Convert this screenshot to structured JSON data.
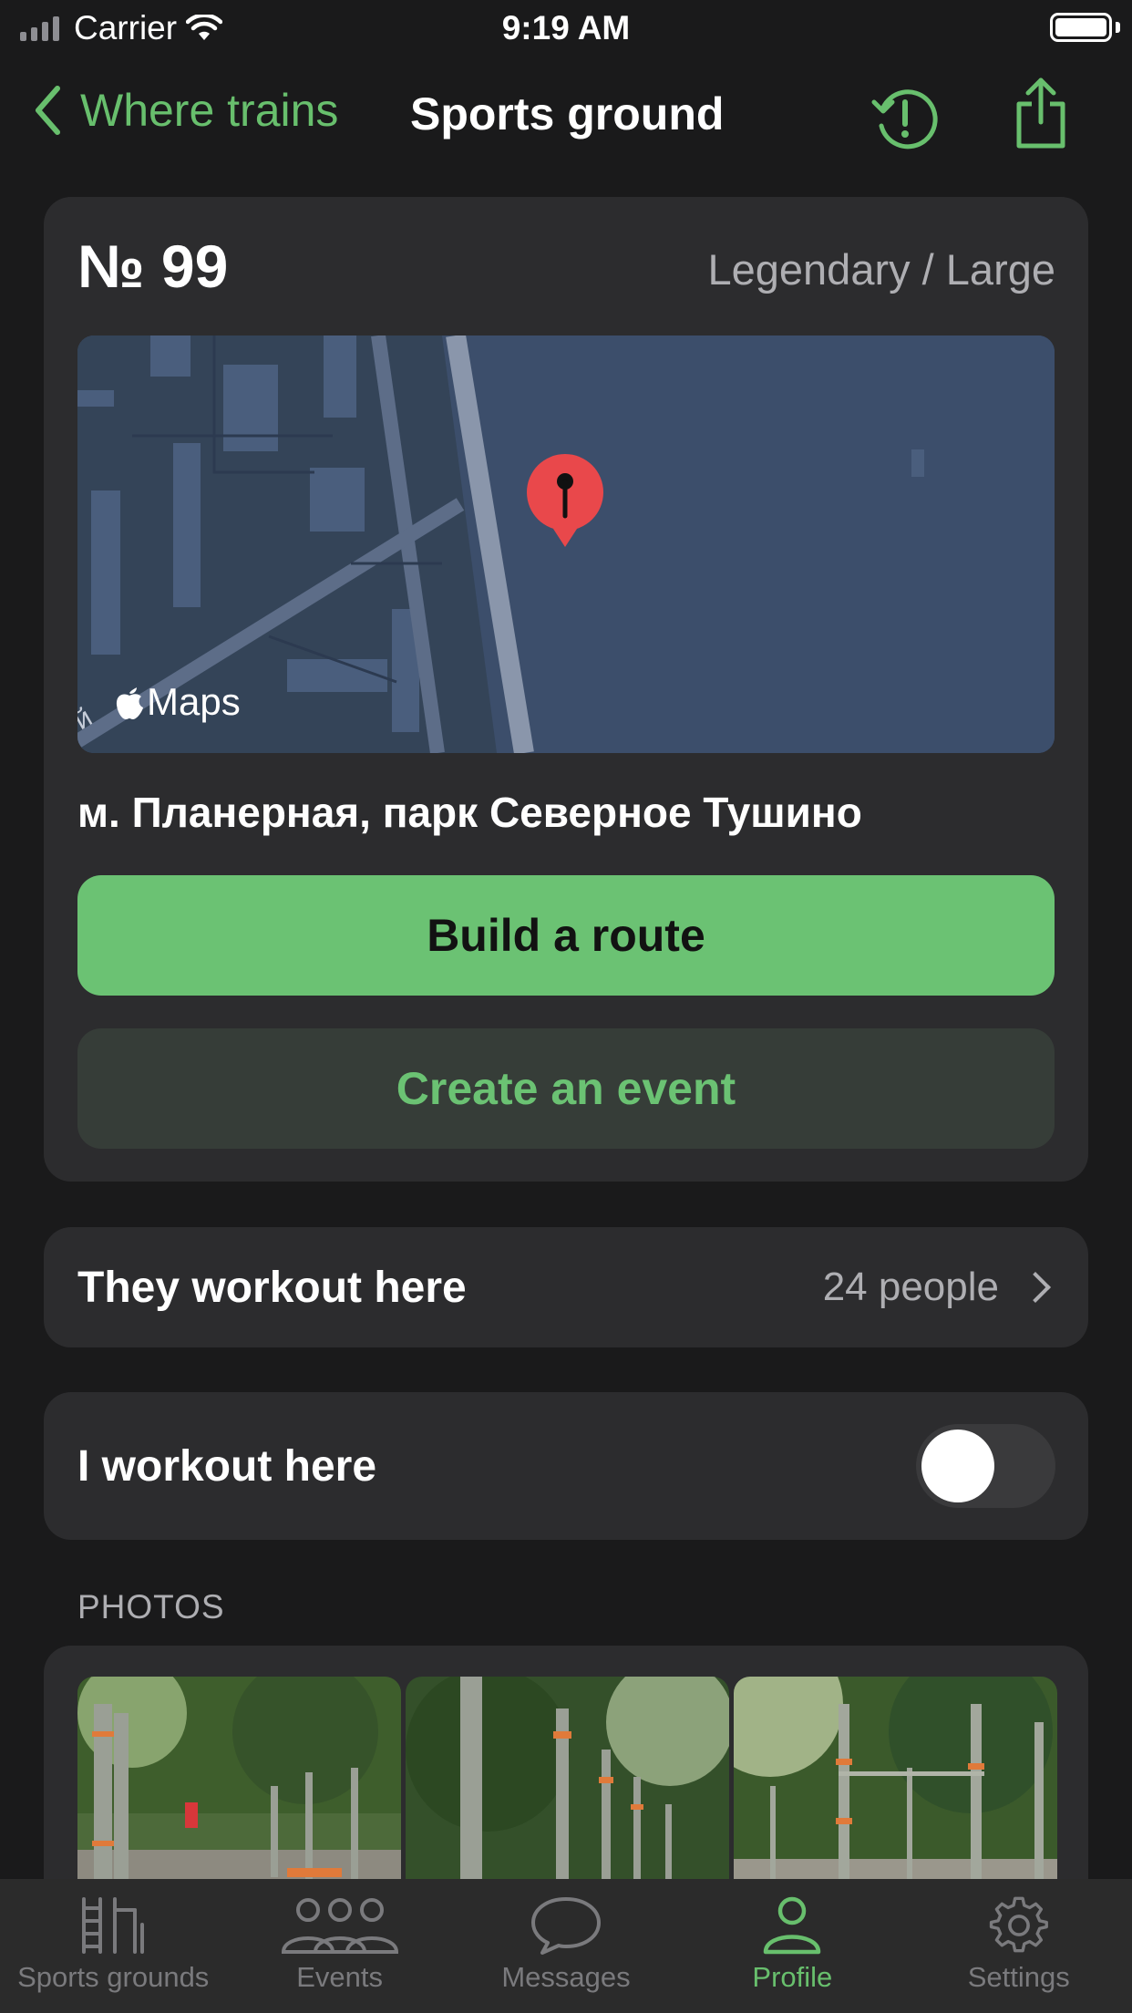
{
  "status_bar": {
    "carrier": "Carrier",
    "time": "9:19 AM"
  },
  "nav": {
    "back_label": "Where trains",
    "title": "Sports ground"
  },
  "ground": {
    "number": "№ 99",
    "grade": "Legendary / Large",
    "map_logo": "Maps",
    "map_edge_label": "й",
    "address": "м. Планерная, парк Северное Тушино"
  },
  "actions": {
    "route_label": "Build a route",
    "event_label": "Create an event"
  },
  "participants": {
    "label": "They workout here",
    "value": "24 people"
  },
  "my_workout": {
    "label": "I workout here",
    "enabled": false
  },
  "photos": {
    "section_title": "PHOTOS",
    "count_visible": 3
  },
  "tabbar": {
    "items": [
      {
        "label": "Sports grounds",
        "icon": "wall-bars-icon",
        "active": false
      },
      {
        "label": "Events",
        "icon": "group-icon",
        "active": false
      },
      {
        "label": "Messages",
        "icon": "speech-bubble-icon",
        "active": false
      },
      {
        "label": "Profile",
        "icon": "person-icon",
        "active": true
      },
      {
        "label": "Settings",
        "icon": "gear-icon",
        "active": false
      }
    ]
  },
  "colors": {
    "accent": "#68bf6d",
    "background": "#1a1a1b",
    "card": "#2c2c2e",
    "map_pin": "#e9484b"
  }
}
